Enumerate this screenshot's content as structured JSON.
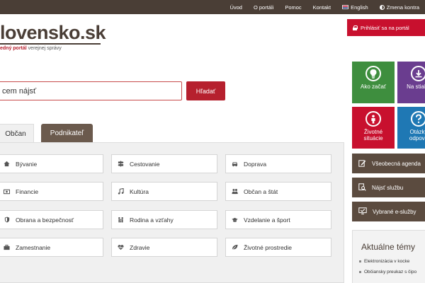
{
  "topnav": {
    "items": [
      "Úvod",
      "O portáli",
      "Pomoc",
      "Kontakt"
    ],
    "language": "English",
    "contrast": "Zmena kontra"
  },
  "logo": {
    "name": "lovensko.sk",
    "tag_red": "edný portál",
    "tag_rest": " verejnej správy"
  },
  "login": {
    "label": "Prihlásiť sa na portál"
  },
  "search": {
    "value": "cem nájsť",
    "button": "Hľadať"
  },
  "tabs": {
    "obcan": "Občan",
    "podnikatel": "Podnikateľ"
  },
  "categories": [
    {
      "label": "Bývanie",
      "icon": "home-icon"
    },
    {
      "label": "Cestovanie",
      "icon": "signpost-icon"
    },
    {
      "label": "Doprava",
      "icon": "car-icon"
    },
    {
      "label": "Financie",
      "icon": "money-icon"
    },
    {
      "label": "Kultúra",
      "icon": "music-icon"
    },
    {
      "label": "Občan a štát",
      "icon": "people-icon"
    },
    {
      "label": "Obrana a bezpečnosť",
      "icon": "shield-icon"
    },
    {
      "label": "Rodina a vzťahy",
      "icon": "family-icon"
    },
    {
      "label": "Vzdelanie a šport",
      "icon": "graduation-cap-icon"
    },
    {
      "label": "Zamestnanie",
      "icon": "briefcase-icon"
    },
    {
      "label": "Zdravie",
      "icon": "heart-icon"
    },
    {
      "label": "Životné prostredie",
      "icon": "leaf-icon"
    }
  ],
  "tiles": {
    "ako_zacat": "Ako začať",
    "na_stiahnutie": "Na stiahn",
    "zivotne_situacie_1": "Životné",
    "zivotne_situacie_2": "situácie",
    "otazky_1": "Otázky",
    "otazky_2": "odpove"
  },
  "services": [
    "Všeobecná agenda",
    "Nájsť službu",
    "Vybrané e-služby"
  ],
  "news": {
    "title": "Aktuálne témy",
    "items": [
      "Elektronizácia v kocke",
      "Občiansky preukaz s čipo"
    ]
  },
  "colors": {
    "topbar": "#4a3e36",
    "brand_red": "#b6202e",
    "login_red": "#c8102e",
    "tile_green": "#3e8e3e",
    "tile_purple": "#6a3d8f",
    "tile_red": "#c8102e",
    "tile_blue": "#1f78b4",
    "service_brown": "#5b4b3f"
  }
}
